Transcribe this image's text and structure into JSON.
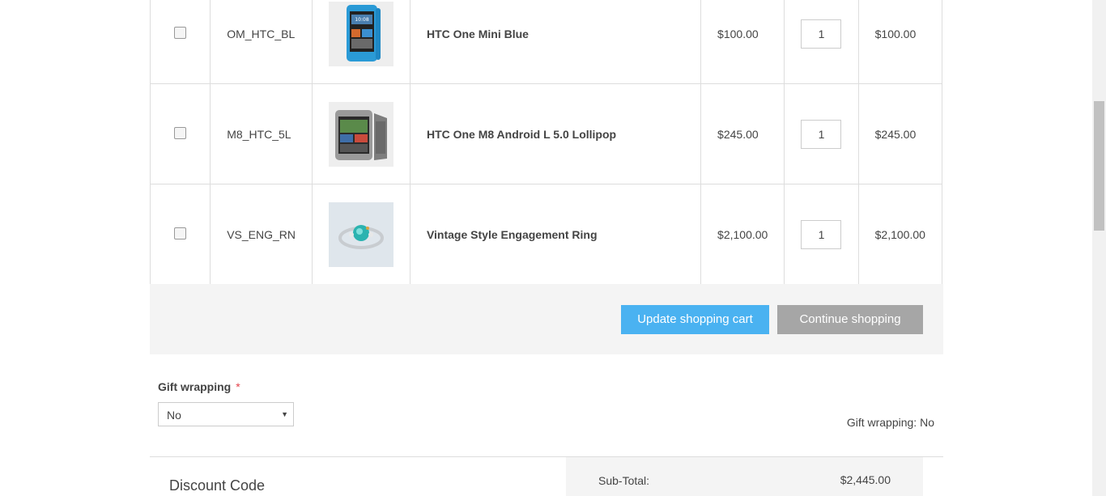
{
  "cart": {
    "items": [
      {
        "sku": "OM_HTC_BL",
        "name": "HTC One Mini Blue",
        "price": "$100.00",
        "qty": "1",
        "total": "$100.00",
        "image_icon": "blue-phone-thumbnail"
      },
      {
        "sku": "M8_HTC_5L",
        "name": "HTC One M8 Android L 5.0 Lollipop",
        "price": "$245.00",
        "qty": "1",
        "total": "$245.00",
        "image_icon": "gray-phone-thumbnail"
      },
      {
        "sku": "VS_ENG_RN",
        "name": "Vintage Style Engagement Ring",
        "price": "$2,100.00",
        "qty": "1",
        "total": "$2,100.00",
        "image_icon": "ring-thumbnail"
      }
    ]
  },
  "actions": {
    "update_label": "Update shopping cart",
    "continue_label": "Continue shopping"
  },
  "gift": {
    "label": "Gift wrapping",
    "required_mark": "*",
    "selected": "No",
    "summary": "Gift wrapping: No"
  },
  "discount": {
    "title": "Discount Code"
  },
  "totals": {
    "subtotal_label": "Sub-Total:",
    "subtotal_value": "$2,445.00"
  },
  "colors": {
    "update_button": "#4ab2f1",
    "continue_button": "#a6a6a6",
    "required": "#e4434b"
  }
}
